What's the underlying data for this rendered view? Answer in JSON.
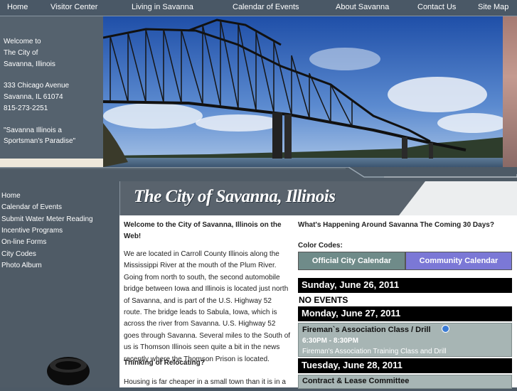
{
  "nav": [
    {
      "label": "Home"
    },
    {
      "label": "Visitor Center"
    },
    {
      "label": "Living in Savanna"
    },
    {
      "label": "Calendar of Events"
    },
    {
      "label": "About Savanna"
    },
    {
      "label": "Contact Us"
    },
    {
      "label": "Site Map"
    }
  ],
  "info": {
    "welcome_1": "Welcome to",
    "welcome_2": "The City of",
    "welcome_3": "Savanna, Illinois",
    "address_1": "333 Chicago Avenue",
    "address_2": "Savanna, IL 61074",
    "phone": "815-273-2251",
    "slogan_1": "\"Savanna Illinois a",
    "slogan_2": "Sportsman's Paradise\""
  },
  "sidebar": {
    "items": [
      {
        "label": "Home"
      },
      {
        "label": "Calendar of Events"
      },
      {
        "label": "Submit Water Meter Reading"
      },
      {
        "label": "Incentive Programs"
      },
      {
        "label": "On-line Forms"
      },
      {
        "label": "City Codes"
      },
      {
        "label": "Photo Album"
      }
    ]
  },
  "main": {
    "title": "The City of Savanna, Illinois",
    "welcome_heading_1": "Welcome to the City of Savanna, Illinois on the",
    "welcome_heading_2": "Web!",
    "intro_lines": [
      "We are located in Carroll County Illinois along the",
      "Mississippi River at the mouth of the Plum River.",
      "Going from north to south, the second automobile",
      "bridge between Iowa and Illinois is located just north",
      "of Savanna, and is part of the U.S. Highway 52",
      "route. The bridge leads to Sabula, Iowa, which is",
      "across the river from Savanna. U.S. Highway 52",
      "goes through Savanna. Several miles to the South of",
      "us is Thomson Illinois seen quite a bit in the news",
      "recently where the Thomson Prison is located."
    ],
    "relocating_heading": "Thinking of Relocating?",
    "relocating_line": "Housing is far cheaper in a small town than it is in a"
  },
  "calendar": {
    "heading": "What's Happening Around Savanna The Coming 30 Days?",
    "color_codes_label": "Color Codes:",
    "official_button": "Official City Calendar",
    "community_button": "Community Calendar",
    "official_color": "#6f8b89",
    "community_color": "#7b78d6",
    "days": [
      {
        "date": "Sunday, June 26, 2011",
        "no_events": "NO EVENTS"
      },
      {
        "date": "Monday, June 27, 2011"
      },
      {
        "date": "Tuesday, June 28, 2011"
      }
    ],
    "events": [
      {
        "title": "Fireman`s Association Class / Drill",
        "time": "6:30PM - 8:30PM",
        "description": "Fireman's Association Training Class and Drill"
      },
      {
        "title": "Contract & Lease Committee"
      }
    ]
  }
}
